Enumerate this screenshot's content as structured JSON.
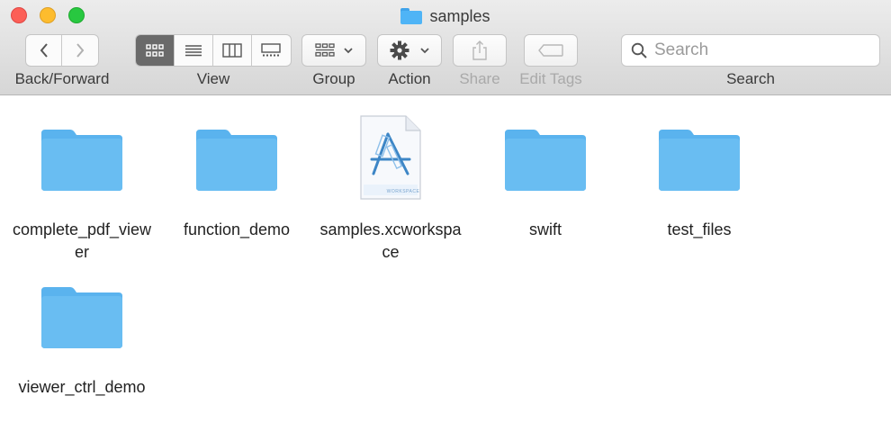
{
  "window": {
    "title": "samples"
  },
  "toolbar": {
    "back_forward_label": "Back/Forward",
    "view_label": "View",
    "group_label": "Group",
    "action_label": "Action",
    "share_label": "Share",
    "edit_tags_label": "Edit Tags",
    "search_label": "Search",
    "search_placeholder": "Search",
    "active_view": "icons",
    "accent_color": "#6a6a6a"
  },
  "files": [
    {
      "name": "complete_pdf_viewer",
      "kind": "folder"
    },
    {
      "name": "function_demo",
      "kind": "folder"
    },
    {
      "name": "samples.xcworkspace",
      "kind": "xcworkspace",
      "badge": "WORKSPACE"
    },
    {
      "name": "swift",
      "kind": "folder"
    },
    {
      "name": "test_files",
      "kind": "folder"
    },
    {
      "name": "viewer_ctrl_demo",
      "kind": "folder"
    }
  ],
  "colors": {
    "folder": "#69bdf2",
    "folder_tab": "#5ab3ee"
  }
}
